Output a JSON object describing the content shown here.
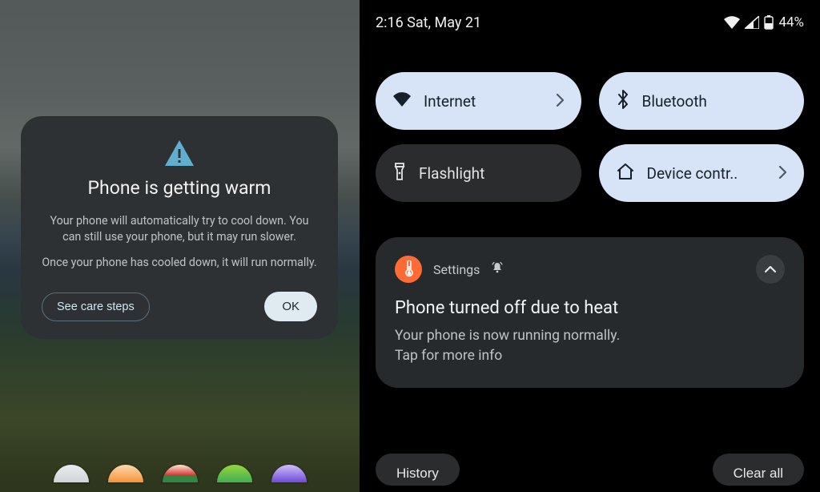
{
  "dialog": {
    "title": "Phone is getting warm",
    "para1": "Your phone will automatically try to cool down. You can still use your phone, but it may run slower.",
    "para2": "Once your phone has cooled down, it will run normally.",
    "care_label": "See care steps",
    "ok_label": "OK"
  },
  "status": {
    "clock_date": "2:16 Sat, May 21",
    "battery_text": "44%"
  },
  "tiles": {
    "internet": "Internet",
    "bluetooth": "Bluetooth",
    "flashlight": "Flashlight",
    "device_controls": "Device contr.."
  },
  "notification": {
    "app_name": "Settings",
    "title": "Phone turned off due to heat",
    "body_line1": "Your phone is now running normally.",
    "body_line2": "Tap for more info"
  },
  "footer": {
    "history": "History",
    "clear_all": "Clear all"
  }
}
